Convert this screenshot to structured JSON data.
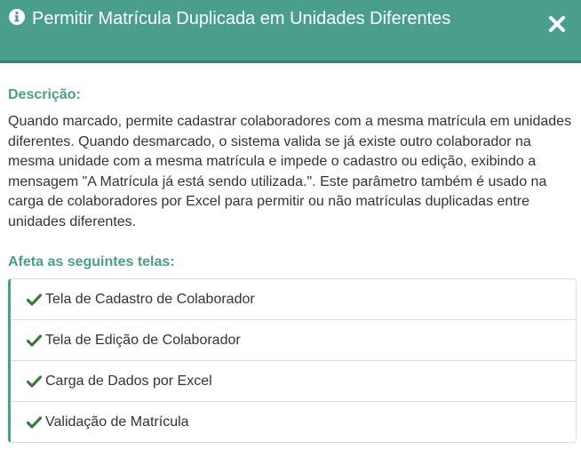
{
  "header": {
    "title": "Permitir Matrícula Duplicada em Unidades Diferentes",
    "info_icon": "info-circle-icon",
    "close_icon": "close-icon"
  },
  "description": {
    "label": "Descrição:",
    "text": "Quando marcado, permite cadastrar colaboradores com a mesma matrícula em unidades diferentes. Quando desmarcado, o sistema valida se já existe outro colaborador na mesma unidade com a mesma matrícula e impede o cadastro ou edição, exibindo a mensagem \"A Matrícula já está sendo utilizada.\". Este parâmetro também é usado na carga de colaboradores por Excel para permitir ou não matrículas duplicadas entre unidades diferentes."
  },
  "affects": {
    "label": "Afeta as seguintes telas:",
    "items": [
      {
        "label": "Tela de Cadastro de Colaborador",
        "icon": "check-icon"
      },
      {
        "label": "Tela de Edição de Colaborador",
        "icon": "check-icon"
      },
      {
        "label": "Carga de Dados por Excel",
        "icon": "check-icon"
      },
      {
        "label": "Validação de Matrícula",
        "icon": "check-icon"
      }
    ]
  },
  "colors": {
    "accent": "#4a9e8c",
    "header_border": "#3b7f70",
    "check": "#3a7d3a",
    "text": "#333333"
  }
}
